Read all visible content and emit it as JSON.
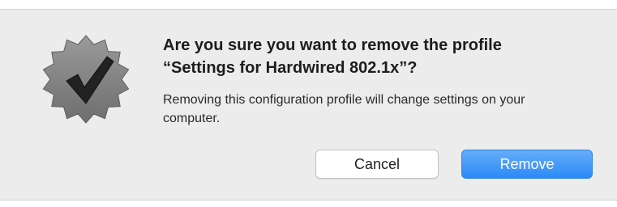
{
  "dialog": {
    "icon": "checkmark-badge-icon",
    "title": "Are you sure you want to remove the profile\n“Settings for Hardwired 802.1x”?",
    "message": "Removing this configuration profile will change settings on your computer.",
    "buttons": {
      "cancel_label": "Cancel",
      "remove_label": "Remove"
    },
    "colors": {
      "background": "#ececec",
      "accent": "#2b8af6",
      "badge": "#7f7f7f"
    }
  }
}
